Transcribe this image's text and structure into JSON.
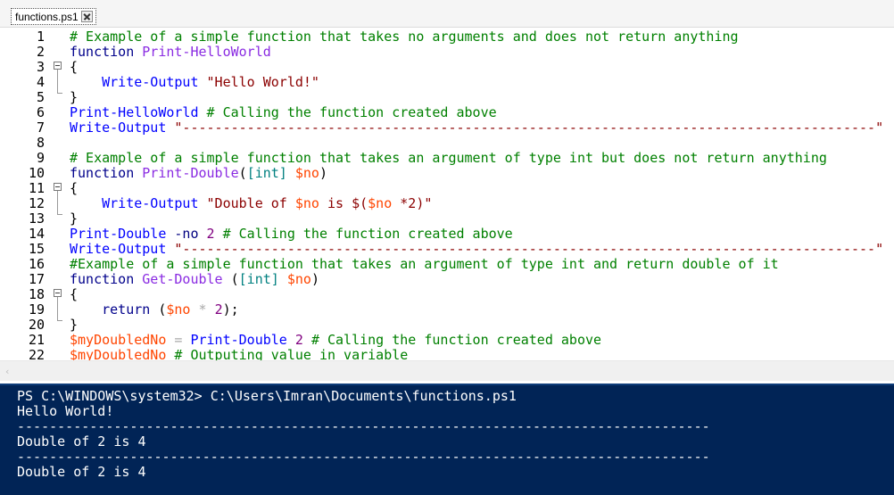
{
  "tab": {
    "label": "functions.ps1",
    "close_icon": "close-icon"
  },
  "scrollbar": {
    "left_arrow": "‹"
  },
  "editor": {
    "lines": [
      {
        "n": "1",
        "tokens": [
          [
            "cm",
            "# Example of a simple function that takes no arguments and does not return anything"
          ]
        ]
      },
      {
        "n": "2",
        "tokens": [
          [
            "kw",
            "function "
          ],
          [
            "fn",
            "Print-HelloWorld"
          ]
        ]
      },
      {
        "n": "3",
        "tokens": [
          [
            "",
            "{"
          ]
        ]
      },
      {
        "n": "4",
        "tokens": [
          [
            "",
            "    "
          ],
          [
            "cmd",
            "Write-Output"
          ],
          [
            "",
            " "
          ],
          [
            "str",
            "\"Hello World!\""
          ]
        ]
      },
      {
        "n": "5",
        "tokens": [
          [
            "",
            "}"
          ]
        ]
      },
      {
        "n": "6",
        "tokens": [
          [
            "cmd",
            "Print-HelloWorld"
          ],
          [
            "",
            " "
          ],
          [
            "cm",
            "# Calling the function created above"
          ]
        ]
      },
      {
        "n": "7",
        "tokens": [
          [
            "cmd",
            "Write-Output"
          ],
          [
            "",
            " "
          ],
          [
            "str",
            "\"--------------------------------------------------------------------------------------\""
          ]
        ]
      },
      {
        "n": "8",
        "tokens": []
      },
      {
        "n": "9",
        "tokens": [
          [
            "cm",
            "# Example of a simple function that takes an argument of type int but does not return anything"
          ]
        ]
      },
      {
        "n": "10",
        "tokens": [
          [
            "kw",
            "function "
          ],
          [
            "fn",
            "Print-Double"
          ],
          [
            "",
            "("
          ],
          [
            "tp",
            "[int]"
          ],
          [
            "",
            " "
          ],
          [
            "var",
            "$no"
          ],
          [
            "",
            ")"
          ]
        ]
      },
      {
        "n": "11",
        "tokens": [
          [
            "",
            "{"
          ]
        ]
      },
      {
        "n": "12",
        "tokens": [
          [
            "",
            "    "
          ],
          [
            "cmd",
            "Write-Output"
          ],
          [
            "",
            " "
          ],
          [
            "str",
            "\"Double of "
          ],
          [
            "var",
            "$no"
          ],
          [
            "str",
            " is $("
          ],
          [
            "var",
            "$no"
          ],
          [
            "str",
            " *2)\""
          ]
        ]
      },
      {
        "n": "13",
        "tokens": [
          [
            "",
            "}"
          ]
        ]
      },
      {
        "n": "14",
        "tokens": [
          [
            "cmd",
            "Print-Double"
          ],
          [
            "",
            " "
          ],
          [
            "pm",
            "-no"
          ],
          [
            "",
            " "
          ],
          [
            "num",
            "2"
          ],
          [
            "",
            " "
          ],
          [
            "cm",
            "# Calling the function created above"
          ]
        ]
      },
      {
        "n": "15",
        "tokens": [
          [
            "cmd",
            "Write-Output"
          ],
          [
            "",
            " "
          ],
          [
            "str",
            "\"--------------------------------------------------------------------------------------\""
          ]
        ]
      },
      {
        "n": "16",
        "tokens": [
          [
            "cm",
            "#Example of a simple function that takes an argument of type int and return double of it"
          ]
        ]
      },
      {
        "n": "17",
        "tokens": [
          [
            "kw",
            "function "
          ],
          [
            "fn",
            "Get-Double"
          ],
          [
            "",
            " ("
          ],
          [
            "tp",
            "[int]"
          ],
          [
            "",
            " "
          ],
          [
            "var",
            "$no"
          ],
          [
            "",
            ")"
          ]
        ]
      },
      {
        "n": "18",
        "tokens": [
          [
            "",
            "{"
          ]
        ]
      },
      {
        "n": "19",
        "tokens": [
          [
            "",
            "    "
          ],
          [
            "kw",
            "return"
          ],
          [
            "",
            " ("
          ],
          [
            "var",
            "$no"
          ],
          [
            "",
            " "
          ],
          [
            "op",
            "*"
          ],
          [
            "",
            " "
          ],
          [
            "num",
            "2"
          ],
          [
            "",
            ");"
          ]
        ]
      },
      {
        "n": "20",
        "tokens": [
          [
            "",
            "}"
          ]
        ]
      },
      {
        "n": "21",
        "tokens": [
          [
            "var",
            "$myDoubledNo"
          ],
          [
            "",
            " "
          ],
          [
            "op",
            "="
          ],
          [
            "",
            " "
          ],
          [
            "cmd",
            "Print-Double"
          ],
          [
            "",
            " "
          ],
          [
            "num",
            "2"
          ],
          [
            "",
            " "
          ],
          [
            "cm",
            "# Calling the function created above"
          ]
        ]
      },
      {
        "n": "22",
        "tokens": [
          [
            "var",
            "$myDoubledNo"
          ],
          [
            "",
            " "
          ],
          [
            "cm",
            "# Outputing value in variable"
          ]
        ]
      }
    ]
  },
  "console": {
    "lines": [
      "PS C:\\WINDOWS\\system32> C:\\Users\\Imran\\Documents\\functions.ps1",
      "Hello World!",
      "--------------------------------------------------------------------------------------",
      "Double of 2 is 4",
      "--------------------------------------------------------------------------------------",
      "Double of 2 is 4"
    ]
  },
  "colors": {
    "console_bg": "#012456",
    "comment": "#008000",
    "keyword": "#00008b",
    "function_name": "#8a2be2",
    "command": "#0000ff",
    "string": "#8b0000",
    "variable": "#ff4500",
    "number": "#800080"
  }
}
